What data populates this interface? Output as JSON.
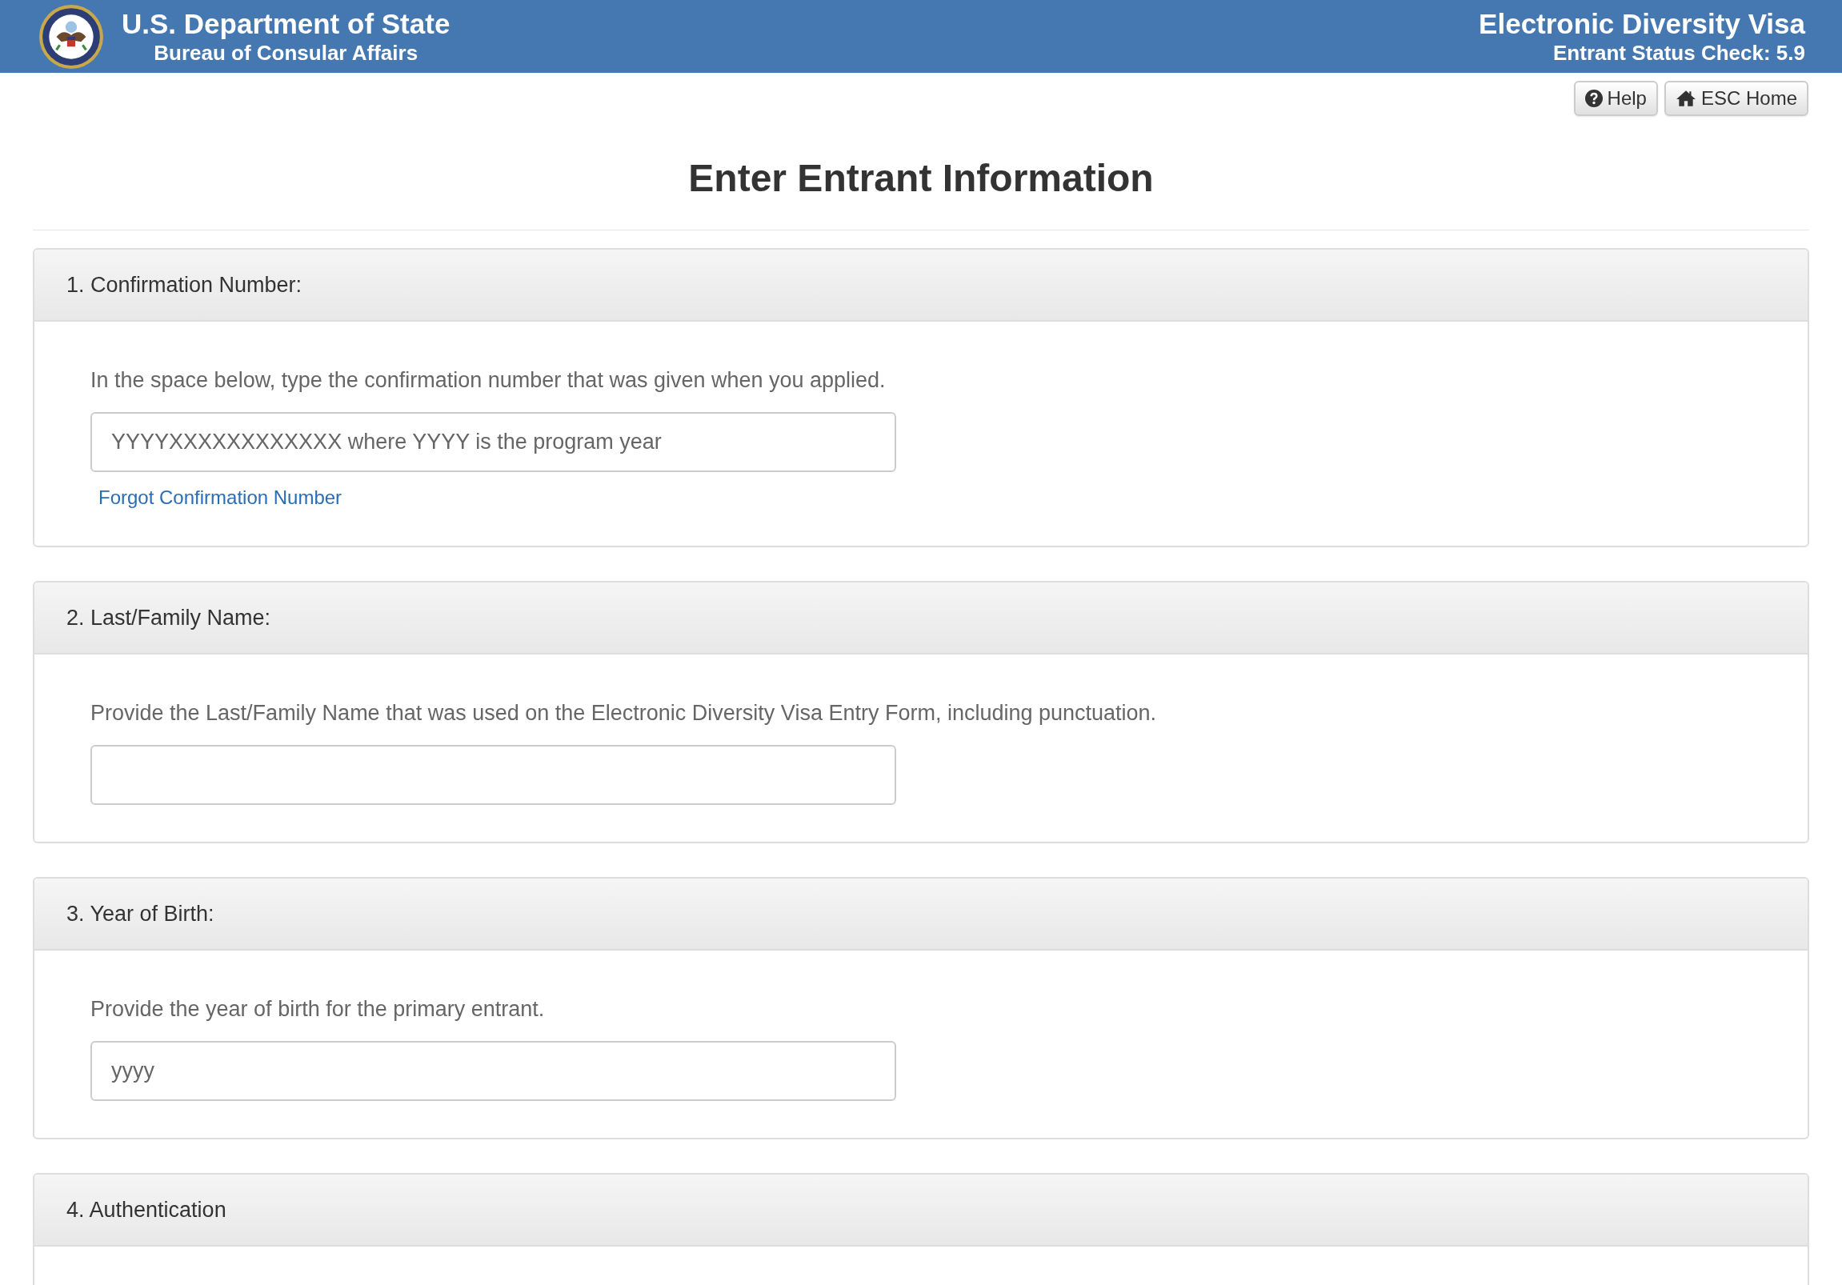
{
  "header": {
    "agency": "U.S. Department of State",
    "bureau": "Bureau of Consular Affairs",
    "program": "Electronic Diversity Visa",
    "app": "Entrant Status Check: 5.9"
  },
  "toolbar": [
    {
      "kind": "help",
      "label": "Help"
    },
    {
      "kind": "home",
      "label": "ESC Home"
    }
  ],
  "page_title": "Enter Entrant Information",
  "sections": [
    {
      "heading": "1. Confirmation Number:",
      "description": "In the space below, type the confirmation number that was given when you applied.",
      "field": {
        "kind": "text",
        "placeholder": "YYYYXXXXXXXXXXXX where YYYY is the program year"
      },
      "link": "Forgot Confirmation Number"
    },
    {
      "heading": "2. Last/Family Name:",
      "description": "Provide the Last/Family Name that was used on the Electronic Diversity Visa Entry Form, including punctuation.",
      "field": {
        "kind": "text"
      }
    },
    {
      "heading": "3. Year of Birth:",
      "description": "Provide the year of birth for the primary entrant.",
      "field": {
        "kind": "text",
        "placeholder": "yyyy"
      }
    },
    {
      "heading": "4. Authentication"
    }
  ]
}
